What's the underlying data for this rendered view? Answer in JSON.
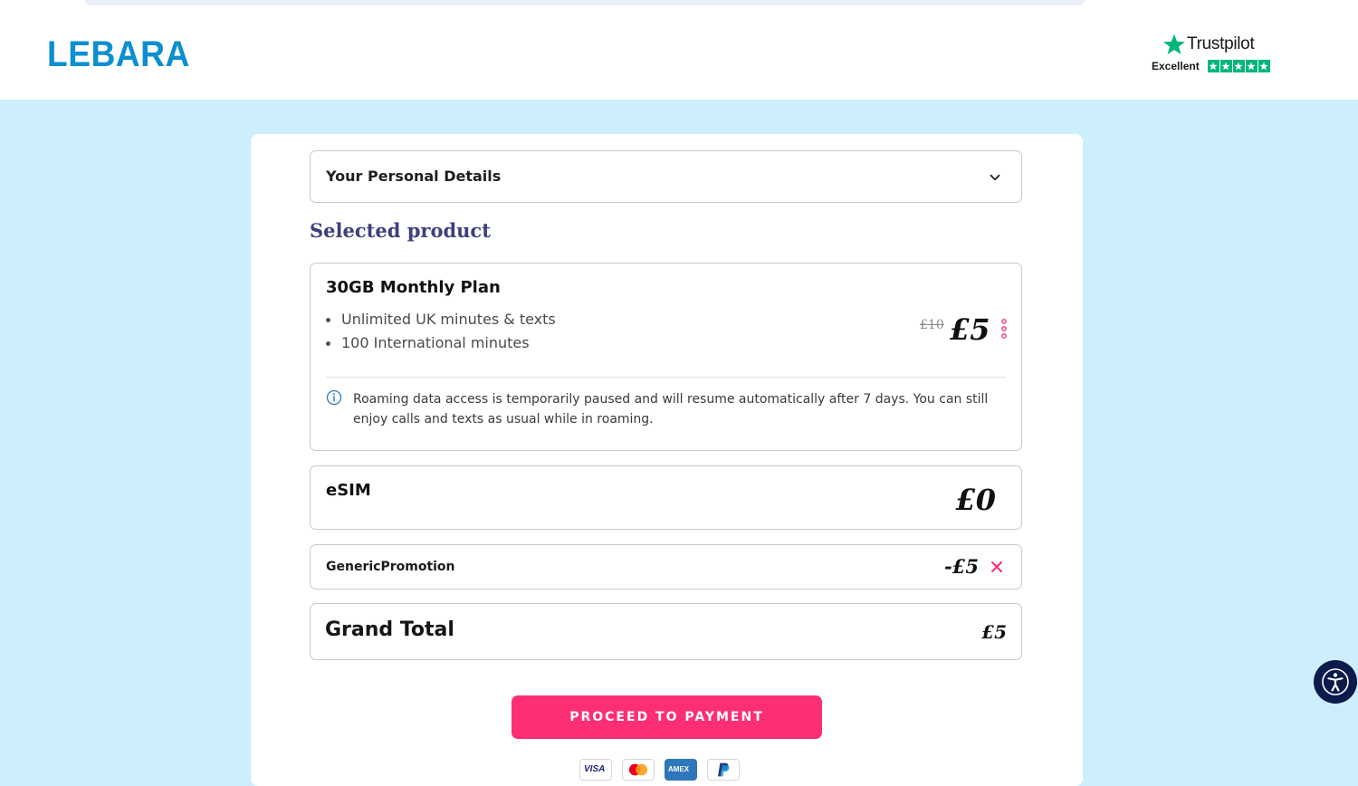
{
  "header": {
    "logo_text": "LEBARA",
    "trustpilot": {
      "name": "Trustpilot",
      "rating_label": "Excellent",
      "stars": 5,
      "star_color": "#00b67a"
    }
  },
  "checkout": {
    "personal_details_label": "Your Personal Details",
    "selected_product_title": "Selected product",
    "plan": {
      "name": "30GB Monthly Plan",
      "features": [
        "Unlimited UK minutes & texts",
        "100 International minutes"
      ],
      "old_price": "£10",
      "price": "£5",
      "notice": "Roaming data access is temporarily paused and will resume automatically after 7 days. You can still enjoy calls and texts as usual while in roaming."
    },
    "esim": {
      "label": "eSIM",
      "price": "£0"
    },
    "promotion": {
      "label": "GenericPromotion",
      "amount": "-£5"
    },
    "grand_total": {
      "label": "Grand Total",
      "amount": "£5"
    },
    "proceed_button": "PROCEED TO PAYMENT",
    "payment_methods": [
      "visa",
      "mastercard",
      "amex",
      "paypal"
    ]
  },
  "colors": {
    "page_bg": "#cdeefc",
    "brand_blue": "#0a8fd1",
    "section_title": "#3d3f7e",
    "cta_pink": "#fe2e74",
    "accessibility_bg": "#0d1b4c"
  },
  "icons": {
    "chevron": "chevron-down-icon",
    "kebab": "more-options-icon",
    "info": "info-icon",
    "remove": "close-icon",
    "accessibility": "accessibility-icon"
  }
}
